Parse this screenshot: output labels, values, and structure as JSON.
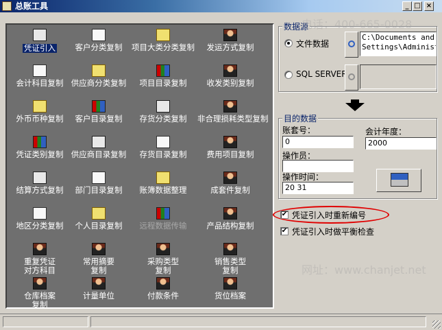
{
  "window": {
    "title": "总账工具",
    "minimize": "_",
    "maximize": "□",
    "close": "×"
  },
  "tools": [
    {
      "label": "凭证引入",
      "icon": "voucher-import-icon",
      "selected": true
    },
    {
      "label": "客户分类复制",
      "icon": "customer-category-copy-icon"
    },
    {
      "label": "项目大类分类复制",
      "icon": "project-major-category-copy-icon"
    },
    {
      "label": "发运方式复制",
      "icon": "shipping-method-copy-icon"
    },
    {
      "label": "会计科目复制",
      "icon": "account-subject-copy-icon"
    },
    {
      "label": "供应商分类复制",
      "icon": "supplier-category-copy-icon"
    },
    {
      "label": "项目目录复制",
      "icon": "project-catalog-copy-icon"
    },
    {
      "label": "收发类别复制",
      "icon": "receive-send-category-copy-icon"
    },
    {
      "label": "外币币种复制",
      "icon": "foreign-currency-copy-icon"
    },
    {
      "label": "客户目录复制",
      "icon": "customer-catalog-copy-icon"
    },
    {
      "label": "存货分类复制",
      "icon": "inventory-category-copy-icon"
    },
    {
      "label": "非合理损耗类型复制",
      "icon": "unreasonable-loss-type-copy-icon"
    },
    {
      "label": "凭证类别复制",
      "icon": "voucher-category-copy-icon"
    },
    {
      "label": "供应商目录复制",
      "icon": "supplier-catalog-copy-icon"
    },
    {
      "label": "存货目录复制",
      "icon": "inventory-catalog-copy-icon"
    },
    {
      "label": "费用项目复制",
      "icon": "expense-item-copy-icon"
    },
    {
      "label": "结算方式复制",
      "icon": "settlement-method-copy-icon"
    },
    {
      "label": "部门目录复制",
      "icon": "department-catalog-copy-icon"
    },
    {
      "label": "账簿数据整理",
      "icon": "ledger-data-cleanup-icon"
    },
    {
      "label": "成套件复制",
      "icon": "kit-copy-icon"
    },
    {
      "label": "地区分类复制",
      "icon": "region-category-copy-icon"
    },
    {
      "label": "个人目录复制",
      "icon": "personal-catalog-copy-icon"
    },
    {
      "label": "远程数据传输",
      "icon": "remote-data-transfer-icon",
      "disabled": true
    },
    {
      "label": "产品结构复制",
      "icon": "product-structure-copy-icon"
    },
    {
      "label": "重复凭证\n对方科目",
      "icon": "repeat-voucher-contra-account-icon"
    },
    {
      "label": "常用摘要\n复制",
      "icon": "common-summary-copy-icon"
    },
    {
      "label": "采购类型\n复制",
      "icon": "purchase-type-copy-icon"
    },
    {
      "label": "销售类型\n复制",
      "icon": "sales-type-copy-icon"
    },
    {
      "label": "仓库档案\n复制",
      "icon": "warehouse-archive-copy-icon"
    },
    {
      "label": "计量单位",
      "icon": "measurement-unit-icon"
    },
    {
      "label": "付款条件",
      "icon": "payment-terms-icon"
    },
    {
      "label": "货位档案",
      "icon": "storage-location-archive-icon"
    }
  ],
  "source": {
    "title": "数据源",
    "file_option": "文件数据",
    "file_path": "C:\\Documents and\nSettings\\Administ",
    "sql_option": "SQL SERVER",
    "sql_value": ""
  },
  "target": {
    "title": "目的数据",
    "account_label": "账套号：",
    "account_value": "0",
    "year_label": "会计年度：",
    "year_value": "2000",
    "operator_label": "操作员：",
    "operator_value": "",
    "time_label": "操作时间：",
    "time_value": "20         31"
  },
  "options": {
    "renumber_label": "凭证引入时重新编号",
    "renumber_checked": true,
    "balance_label": "凭证引入时做平衡检查",
    "balance_checked": true
  },
  "watermark": {
    "phone": "电话：400-665-0028",
    "site": "网址：www.chanjet.net"
  }
}
